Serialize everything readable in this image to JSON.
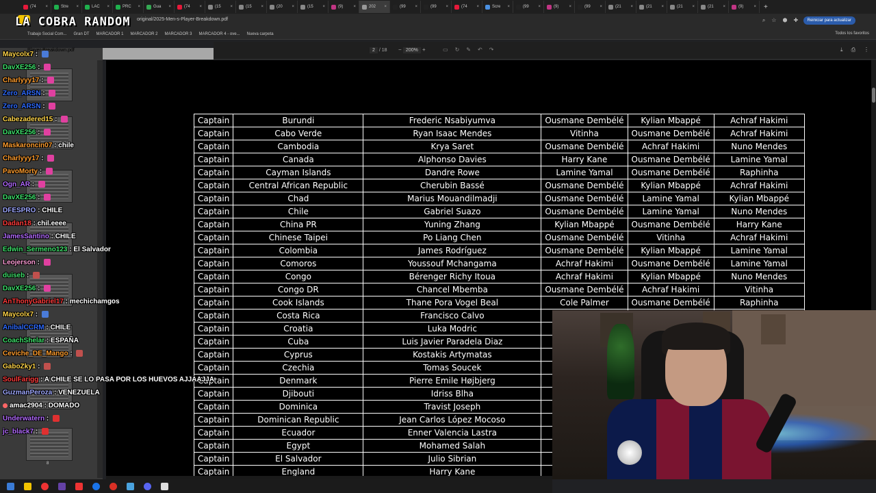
{
  "browser": {
    "tabs": [
      {
        "label": "(74",
        "color": "#e6193a"
      },
      {
        "label": "Stre",
        "color": "#1fb04d"
      },
      {
        "label": "LAC",
        "color": "#1fb04d"
      },
      {
        "label": "PRC",
        "color": "#1fb04d"
      },
      {
        "label": "Gua",
        "color": "#35a853"
      },
      {
        "label": "(74",
        "color": "#e6193a"
      },
      {
        "label": "(15",
        "color": "#888888"
      },
      {
        "label": "(15",
        "color": "#888888"
      },
      {
        "label": "(20",
        "color": "#888888"
      },
      {
        "label": "(15",
        "color": "#888888"
      },
      {
        "label": "(9)",
        "color": "#c13584"
      },
      {
        "label": "202",
        "color": "#999999",
        "active": true
      },
      {
        "label": "(99",
        "color": "#222222"
      },
      {
        "label": "(99",
        "color": "#222222"
      },
      {
        "label": "(74",
        "color": "#e6193a"
      },
      {
        "label": "Scre",
        "color": "#4a90e2"
      },
      {
        "label": "(99",
        "color": "#222222"
      },
      {
        "label": "(9)",
        "color": "#c13584"
      },
      {
        "label": "(99",
        "color": "#222222"
      },
      {
        "label": "(21",
        "color": "#888888"
      },
      {
        "label": "(21",
        "color": "#888888"
      },
      {
        "label": "(21",
        "color": "#888888"
      },
      {
        "label": "(21",
        "color": "#888888"
      },
      {
        "label": "(9)",
        "color": "#c13584"
      }
    ],
    "url": "original/2025-Men-s-Player-Breakdown.pdf",
    "update_button": "Reiniciar para actualizar",
    "bookmarks": [
      "Trabajo Social Com...",
      "Gran DT",
      "MARCADOR 1",
      "MARCADOR 2",
      "MARCADOR 3",
      "MARCADOR 4 - ove...",
      "Nueva carpeta"
    ],
    "bookmarks_right": "Todos los favoritos"
  },
  "overlay": {
    "logo_text": "LA COBRA RANDOM"
  },
  "pdf": {
    "file_label": "Player-Breakdown.pdf",
    "page_current": "2",
    "page_total": "/ 18",
    "zoom": "200%",
    "thumb_page_num": "8",
    "rows": [
      [
        "Captain",
        "Burundi",
        "Frederic Nsabiyumva",
        "Ousmane Dembélé",
        "Kylian Mbappé",
        "Achraf Hakimi"
      ],
      [
        "Captain",
        "Cabo Verde",
        "Ryan Isaac Mendes",
        "Vitinha",
        "Ousmane Dembélé",
        "Achraf Hakimi"
      ],
      [
        "Captain",
        "Cambodia",
        "Krya Saret",
        "Ousmane Dembélé",
        "Achraf Hakimi",
        "Nuno Mendes"
      ],
      [
        "Captain",
        "Canada",
        "Alphonso Davies",
        "Harry Kane",
        "Ousmane Dembélé",
        "Lamine Yamal"
      ],
      [
        "Captain",
        "Cayman Islands",
        "Dandre Rowe",
        "Lamine Yamal",
        "Ousmane Dembélé",
        "Raphinha"
      ],
      [
        "Captain",
        "Central African Republic",
        "Cherubin Bassé",
        "Ousmane Dembélé",
        "Kylian Mbappé",
        "Achraf Hakimi"
      ],
      [
        "Captain",
        "Chad",
        "Marius Mouandilmadji",
        "Ousmane Dembélé",
        "Lamine Yamal",
        "Kylian Mbappé"
      ],
      [
        "Captain",
        "Chile",
        "Gabriel Suazo",
        "Ousmane Dembélé",
        "Lamine Yamal",
        "Nuno Mendes"
      ],
      [
        "Captain",
        "China PR",
        "Yuning Zhang",
        "Kylian Mbappé",
        "Ousmane Dembélé",
        "Harry Kane"
      ],
      [
        "Captain",
        "Chinese Taipei",
        "Po Liang Chen",
        "Ousmane Dembélé",
        "Vitinha",
        "Achraf Hakimi"
      ],
      [
        "Captain",
        "Colombia",
        "James Rodríguez",
        "Ousmane Dembélé",
        "Kylian Mbappé",
        "Lamine Yamal"
      ],
      [
        "Captain",
        "Comoros",
        "Youssouf Mchangama",
        "Achraf Hakimi",
        "Ousmane Dembélé",
        "Lamine Yamal"
      ],
      [
        "Captain",
        "Congo",
        "Bérenger Richy Itoua",
        "Achraf Hakimi",
        "Kylian Mbappé",
        "Nuno Mendes"
      ],
      [
        "Captain",
        "Congo DR",
        "Chancel Mbemba",
        "Ousmane Dembélé",
        "Achraf Hakimi",
        "Vitinha"
      ],
      [
        "Captain",
        "Cook Islands",
        "Thane Pora Vogel Beal",
        "Cole Palmer",
        "Ousmane Dembélé",
        "Raphinha"
      ],
      [
        "Captain",
        "Costa Rica",
        "Francisco Calvo",
        "",
        "",
        ""
      ],
      [
        "Captain",
        "Croatia",
        "Luka Modric",
        "",
        "",
        ""
      ],
      [
        "Captain",
        "Cuba",
        "Luis Javier Paradela Diaz",
        "Ou",
        "",
        ""
      ],
      [
        "Captain",
        "Cyprus",
        "Kostakis Artymatas",
        "Ou",
        "",
        ""
      ],
      [
        "Captain",
        "Czechia",
        "Tomas Soucek",
        "Ou",
        "",
        ""
      ],
      [
        "Captain",
        "Denmark",
        "Pierre Emile Højbjerg",
        "Ou",
        "",
        ""
      ],
      [
        "Captain",
        "Djibouti",
        "Idriss Blha",
        "",
        "",
        ""
      ],
      [
        "Captain",
        "Dominica",
        "Travist Joseph",
        "",
        "",
        ""
      ],
      [
        "Captain",
        "Dominican Republic",
        "Jean Carlos López Mocoso",
        "",
        "",
        ""
      ],
      [
        "Captain",
        "Ecuador",
        "Enner Valencia Lastra",
        "Ou",
        "",
        ""
      ],
      [
        "Captain",
        "Egypt",
        "Mohamed Salah",
        "",
        "",
        ""
      ],
      [
        "Captain",
        "El Salvador",
        "Julio Sibrian",
        "Ou",
        "",
        ""
      ],
      [
        "Captain",
        "England",
        "Harry Kane",
        "",
        "",
        ""
      ]
    ]
  },
  "chat": [
    {
      "user": "Maycolx7",
      "color": "#ffd54a",
      "msg": "",
      "emote": "#4a7bd8"
    },
    {
      "user": "DavXE256",
      "color": "#3ee06b",
      "msg": "",
      "emote": "#e040a0"
    },
    {
      "user": "Charlyyy17",
      "color": "#ff9d2e",
      "msg": "",
      "emote": "#e040a0"
    },
    {
      "user": "Zero_ARSN",
      "color": "#2f6bff",
      "msg": "",
      "emote": "#e040a0"
    },
    {
      "user": "Zero_ARSN",
      "color": "#2f6bff",
      "msg": "",
      "emote": "#e040a0"
    },
    {
      "user": "Cabezadered15",
      "color": "#ffd54a",
      "msg": "",
      "emote": "#e040a0"
    },
    {
      "user": "DavXE256",
      "color": "#3ee06b",
      "msg": "",
      "emote": "#e040a0"
    },
    {
      "user": "Maskaroncin07",
      "color": "#ff9d2e",
      "msg": "chile",
      "emote": ""
    },
    {
      "user": "Charlyyy17",
      "color": "#ff9d2e",
      "msg": "",
      "emote": "#e040a0"
    },
    {
      "user": "PavoMorty",
      "color": "#ff9d2e",
      "msg": "",
      "emote": "#e040a0"
    },
    {
      "user": "Ogn_AR",
      "color": "#b36bff",
      "msg": "",
      "emote": "#e040a0"
    },
    {
      "user": "DavXE256",
      "color": "#3ee06b",
      "msg": "",
      "emote": "#e040a0"
    },
    {
      "user": "DFESPRO",
      "color": "#9fa8ff",
      "msg": "CHILE",
      "emote": ""
    },
    {
      "user": "Dadan18",
      "color": "#ff3b3b",
      "msg": "chil.eeee",
      "emote": ""
    },
    {
      "user": "JamesSantino",
      "color": "#b36bff",
      "msg": "CHILE",
      "emote": ""
    },
    {
      "user": "Edwin_Sermeno123",
      "color": "#3ee06b",
      "msg": "El Salvador",
      "emote": ""
    },
    {
      "user": "Leojerson",
      "color": "#ff9dd6",
      "msg": "",
      "emote": "#e040a0"
    },
    {
      "user": "duiseb",
      "color": "#3ee06b",
      "msg": "",
      "emote": "#c0504d"
    },
    {
      "user": "DavXE256",
      "color": "#3ee06b",
      "msg": "",
      "emote": "#e040a0"
    },
    {
      "user": "AnThonyGabriel17",
      "color": "#ff3b3b",
      "msg": "mechichamgos",
      "emote": ""
    },
    {
      "user": "Maycolx7",
      "color": "#ffd54a",
      "msg": "",
      "emote": "#4a7bd8"
    },
    {
      "user": "AnibalCCRM",
      "color": "#2f6bff",
      "msg": "CHILE",
      "emote": ""
    },
    {
      "user": "CoachShelar",
      "color": "#3ee06b",
      "msg": "ESPAÑA",
      "emote": ""
    },
    {
      "user": "Ceviche_DE_Mango",
      "color": "#ff9d2e",
      "msg": "",
      "emote": "#c0504d"
    },
    {
      "user": "GaboZky1",
      "color": "#ffd54a",
      "msg": "",
      "emote": "#c0504d"
    },
    {
      "user": "SoulFarigg",
      "color": "#ff3b3b",
      "msg": "A CHILE SE LO PASA POR LOS HUEVOS AJJAAJJA",
      "emote": ""
    },
    {
      "user": "GuzmanPeroza",
      "color": "#9fa8ff",
      "msg": "VENEZUELA",
      "emote": ""
    },
    {
      "user": "amac2904",
      "color": "#ffffff",
      "msg": "DOMADO",
      "emote": "",
      "dot": true
    },
    {
      "user": "Underwatern",
      "color": "#b36bff",
      "msg": "",
      "emote": "#e03030"
    },
    {
      "user": "jc_black7",
      "color": "#b36bff",
      "msg": "",
      "emote": "#e03030"
    }
  ],
  "colors": {
    "chrome_bg": "#1f1f1f",
    "doc_bg": "#000000",
    "table_text": "#ffffff",
    "update_button": "#2b5cab"
  }
}
